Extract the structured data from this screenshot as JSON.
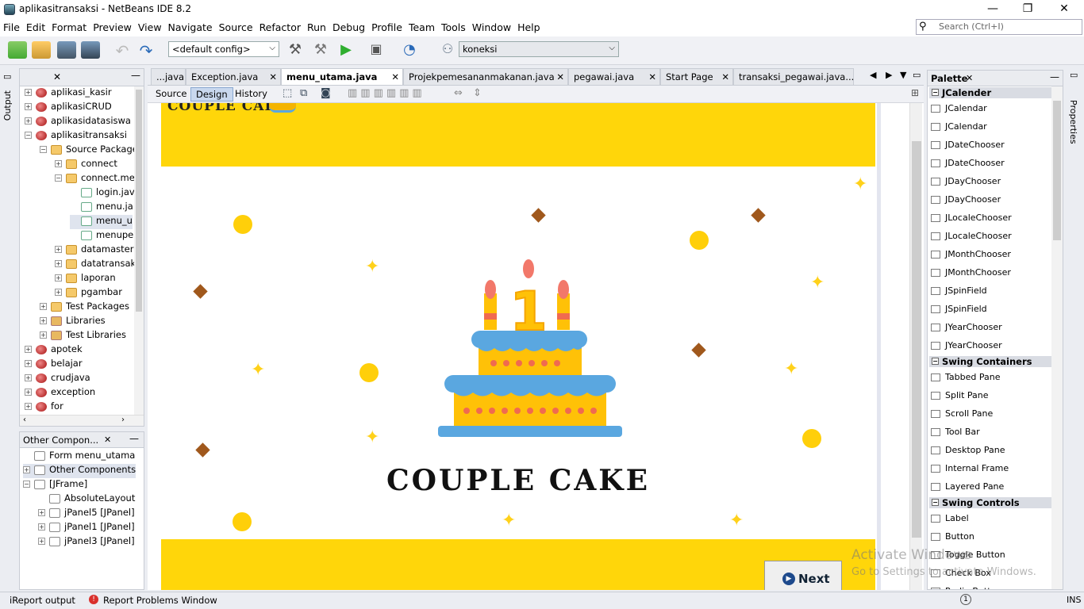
{
  "window": {
    "title": "aplikasitransaksi - NetBeans IDE 8.2",
    "minimize": "—",
    "restore": "❐",
    "close": "✕"
  },
  "menubar": {
    "items": [
      "File",
      "Edit",
      "Format",
      "Preview",
      "View",
      "Navigate",
      "Source",
      "Refactor",
      "Run",
      "Debug",
      "Profile",
      "Team",
      "Tools",
      "Window",
      "Help"
    ]
  },
  "search": {
    "placeholder": "Search (Ctrl+I)"
  },
  "toolbar": {
    "config": "<default config>",
    "connection": "koneksi"
  },
  "left_strip": {
    "output_label": "Output"
  },
  "projects": {
    "tree": [
      {
        "label": "aplikasi_kasir",
        "toggle": "+",
        "icon": "project"
      },
      {
        "label": "aplikasiCRUD",
        "toggle": "+",
        "icon": "project"
      },
      {
        "label": "aplikasidatasiswa",
        "toggle": "+",
        "icon": "project"
      },
      {
        "label": "aplikasitransaksi",
        "toggle": "−",
        "icon": "project"
      },
      {
        "label": "Source Package",
        "toggle": "−",
        "icon": "package"
      },
      {
        "label": "connect",
        "toggle": "+",
        "icon": "package"
      },
      {
        "label": "connect.me",
        "toggle": "−",
        "icon": "package"
      },
      {
        "label": "login.jav",
        "toggle": "",
        "icon": "file"
      },
      {
        "label": "menu.ja",
        "toggle": "",
        "icon": "file"
      },
      {
        "label": "menu_u",
        "toggle": "",
        "icon": "file"
      },
      {
        "label": "menupe",
        "toggle": "",
        "icon": "file"
      },
      {
        "label": "datamaster",
        "toggle": "+",
        "icon": "package"
      },
      {
        "label": "datatransak",
        "toggle": "+",
        "icon": "package"
      },
      {
        "label": "laporan",
        "toggle": "+",
        "icon": "package"
      },
      {
        "label": "pgambar",
        "toggle": "+",
        "icon": "package"
      },
      {
        "label": "Test Packages",
        "toggle": "+",
        "icon": "package"
      },
      {
        "label": "Libraries",
        "toggle": "+",
        "icon": "library"
      },
      {
        "label": "Test Libraries",
        "toggle": "+",
        "icon": "library"
      },
      {
        "label": "apotek",
        "toggle": "+",
        "icon": "project"
      },
      {
        "label": "belajar",
        "toggle": "+",
        "icon": "project"
      },
      {
        "label": "crudjava",
        "toggle": "+",
        "icon": "project"
      },
      {
        "label": "exception",
        "toggle": "+",
        "icon": "project"
      },
      {
        "label": "for",
        "toggle": "+",
        "icon": "project"
      }
    ]
  },
  "navigator": {
    "title": "Other Compon...",
    "tree": [
      {
        "label": "Form menu_utama",
        "toggle": ""
      },
      {
        "label": "Other Components",
        "toggle": "+"
      },
      {
        "label": "[JFrame]",
        "toggle": "−"
      },
      {
        "label": "AbsoluteLayout",
        "toggle": ""
      },
      {
        "label": "jPanel5 [JPanel]",
        "toggle": "+"
      },
      {
        "label": "jPanel1 [JPanel]",
        "toggle": "+"
      },
      {
        "label": "jPanel3 [JPanel]",
        "toggle": "+"
      }
    ]
  },
  "editor": {
    "tabs": [
      {
        "label": "...java",
        "active": false
      },
      {
        "label": "Exception.java",
        "active": false
      },
      {
        "label": "menu_utama.java",
        "active": true
      },
      {
        "label": "Projekpemesananmakanan.java",
        "active": false
      },
      {
        "label": "pegawai.java",
        "active": false
      },
      {
        "label": "Start Page",
        "active": false
      },
      {
        "label": "transaksi_pegawai.java...",
        "active": false
      }
    ],
    "views": {
      "source": "Source",
      "design": "Design",
      "history": "History"
    }
  },
  "form": {
    "top_brand": "COUPLE CAKE",
    "brand": "COUPLE CAKE",
    "cake_number": "1",
    "next_button": "Next"
  },
  "palette": {
    "title": "Palette",
    "categories": [
      {
        "name": "JCalender",
        "items": [
          "JCalendar",
          "JCalendar",
          "JDateChooser",
          "JDateChooser",
          "JDayChooser",
          "JDayChooser",
          "JLocaleChooser",
          "JLocaleChooser",
          "JMonthChooser",
          "JMonthChooser",
          "JSpinField",
          "JSpinField",
          "JYearChooser",
          "JYearChooser"
        ]
      },
      {
        "name": "Swing Containers",
        "items": [
          "Tabbed Pane",
          "Split Pane",
          "Scroll Pane",
          "Tool Bar",
          "Desktop Pane",
          "Internal Frame",
          "Layered Pane"
        ]
      },
      {
        "name": "Swing Controls",
        "items": [
          "Label",
          "Button",
          "Toggle Button",
          "Check Box",
          "Radio Button"
        ]
      }
    ]
  },
  "right_strip": {
    "properties_label": "Properties"
  },
  "statusbar": {
    "ireport": "iReport output",
    "problems": "Report Problems Window",
    "notifications": "1",
    "mode": "INS"
  },
  "watermark": {
    "line1": "Activate Windows",
    "line2": "Go to Settings to activate Windows."
  },
  "colors": {
    "band_yellow": "#ffd60a",
    "diamond_brown": "#a0581c",
    "next_icon_blue": "#1e4a8c"
  }
}
